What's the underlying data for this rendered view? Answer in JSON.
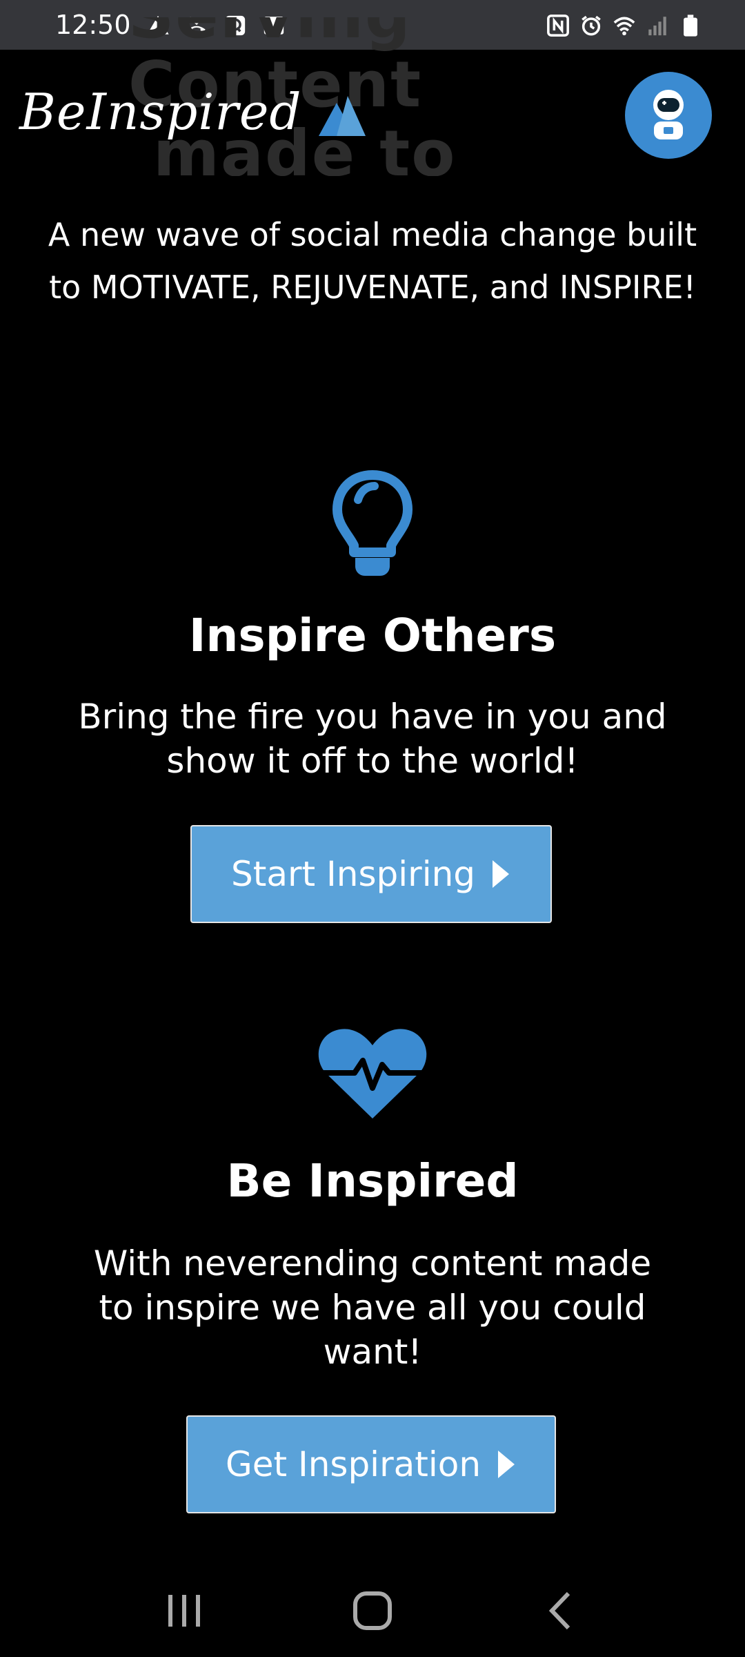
{
  "status_bar": {
    "time": "12:50",
    "icons_left": [
      "warning-icon",
      "missed-call-icon",
      "chat-icon",
      "image-icon"
    ],
    "icons_right": [
      "nfc-icon",
      "alarm-icon",
      "wifi-icon",
      "signal-icon",
      "battery-icon"
    ]
  },
  "header": {
    "background_text_line1": "Serving Content",
    "background_text_line2": "made to Inspire",
    "brand_name": "BeInspired",
    "logo_icon": "mountain-logo-icon",
    "avatar_icon": "astronaut-avatar-icon"
  },
  "tagline": "A new wave of social media change built to MOTIVATE, REJUVENATE, and INSPIRE!",
  "features": [
    {
      "icon": "lightbulb-icon",
      "title": "Inspire Others",
      "description": "Bring the fire you have in you and show it off to the world!",
      "button_label": "Start Inspiring"
    },
    {
      "icon": "heartbeat-icon",
      "title": "Be Inspired",
      "description": "With neverending content made to inspire we have all you could want!",
      "button_label": "Get Inspiration"
    }
  ],
  "nav_bar": {
    "icons": [
      "recent-apps-icon",
      "home-icon",
      "back-icon"
    ]
  },
  "colors": {
    "accent": "#3b8bd1",
    "button": "#5aa2d9",
    "background": "#000000",
    "status_bar": "#35363a"
  }
}
